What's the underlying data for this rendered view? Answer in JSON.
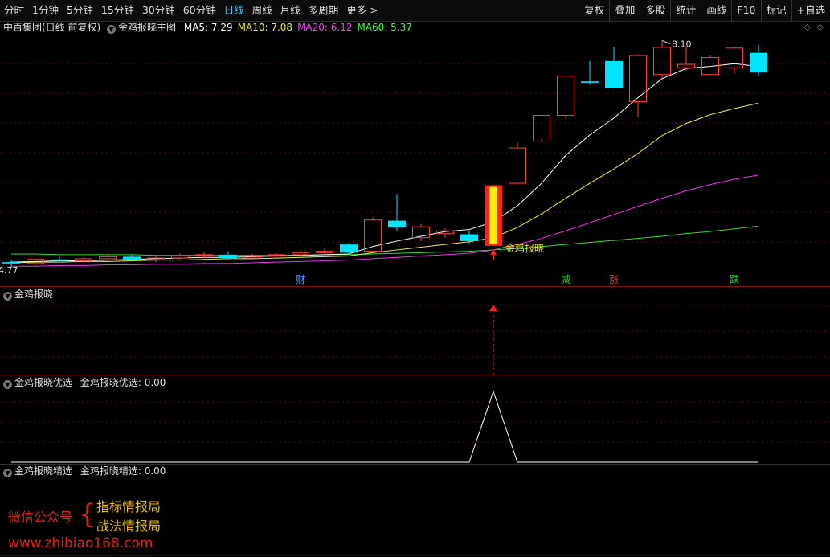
{
  "toolbar": {
    "periods": [
      "分时",
      "1分钟",
      "5分钟",
      "15分钟",
      "30分钟",
      "60分钟",
      "日线",
      "周线",
      "月线",
      "多周期",
      "更多 >"
    ],
    "active_period": "日线",
    "buttons": [
      "复权",
      "叠加",
      "多股",
      "统计",
      "画线",
      "F10",
      "标记",
      "+自选"
    ]
  },
  "main_panel": {
    "stock_title": "中百集团(日线 前复权)",
    "indicator_name": "金鸡报晓主图",
    "ma": [
      {
        "label": "MA5: 7.29",
        "color": "#ffffff"
      },
      {
        "label": "MA10: 7.08",
        "color": "#f0f000"
      },
      {
        "label": "MA20: 6.12",
        "color": "#ff33ff"
      },
      {
        "label": "MA60: 5.37",
        "color": "#33ff33"
      }
    ],
    "high_label": "8.10",
    "low_label": "4.77",
    "signal_label": "金鸡报晓",
    "markers": [
      {
        "text": "财",
        "color": "#4499ff"
      },
      {
        "text": "减",
        "color": "#33cc33"
      },
      {
        "text": "涨",
        "color": "#ff3333"
      },
      {
        "text": "跌",
        "color": "#33cc33"
      }
    ]
  },
  "sub_panel_1": {
    "title": "金鸡报晓"
  },
  "sub_panel_2": {
    "title": "金鸡报晓优选",
    "value_label": "金鸡报晓优选: 0.00"
  },
  "sub_panel_3": {
    "title": "金鸡报晓精选",
    "value_label": "金鸡报晓精选: 0.00"
  },
  "watermark": {
    "label": "微信公众号",
    "line1": "指标情报局",
    "line2": "战法情报局",
    "url": "www.zhibiao168.com"
  },
  "chart_data": {
    "type": "candlestick",
    "candles": [
      {
        "o": 4.84,
        "h": 4.87,
        "l": 4.77,
        "c": 4.82
      },
      {
        "o": 4.82,
        "h": 4.9,
        "l": 4.79,
        "c": 4.88
      },
      {
        "o": 4.88,
        "h": 4.92,
        "l": 4.84,
        "c": 4.86
      },
      {
        "o": 4.86,
        "h": 4.91,
        "l": 4.83,
        "c": 4.89
      },
      {
        "o": 4.89,
        "h": 4.96,
        "l": 4.86,
        "c": 4.92
      },
      {
        "o": 4.92,
        "h": 4.95,
        "l": 4.85,
        "c": 4.87
      },
      {
        "o": 4.87,
        "h": 4.93,
        "l": 4.84,
        "c": 4.9
      },
      {
        "o": 4.9,
        "h": 4.97,
        "l": 4.87,
        "c": 4.94
      },
      {
        "o": 4.94,
        "h": 4.99,
        "l": 4.9,
        "c": 4.95
      },
      {
        "o": 4.95,
        "h": 5.0,
        "l": 4.88,
        "c": 4.9
      },
      {
        "o": 4.9,
        "h": 4.96,
        "l": 4.87,
        "c": 4.93
      },
      {
        "o": 4.93,
        "h": 4.98,
        "l": 4.89,
        "c": 4.95
      },
      {
        "o": 4.95,
        "h": 5.02,
        "l": 4.91,
        "c": 4.98
      },
      {
        "o": 4.98,
        "h": 5.04,
        "l": 4.94,
        "c": 5.0
      },
      {
        "o": 5.1,
        "h": 5.12,
        "l": 4.97,
        "c": 4.98
      },
      {
        "o": 5.0,
        "h": 5.5,
        "l": 4.99,
        "c": 5.46
      },
      {
        "o": 5.45,
        "h": 5.84,
        "l": 5.3,
        "c": 5.35
      },
      {
        "o": 5.2,
        "h": 5.4,
        "l": 5.15,
        "c": 5.36
      },
      {
        "o": 5.26,
        "h": 5.34,
        "l": 5.2,
        "c": 5.3
      },
      {
        "o": 5.25,
        "h": 5.31,
        "l": 5.1,
        "c": 5.15
      },
      {
        "o": 5.08,
        "h": 5.98,
        "l": 5.08,
        "c": 5.97
      },
      {
        "o": 6.0,
        "h": 6.6,
        "l": 5.98,
        "c": 6.52
      },
      {
        "o": 6.62,
        "h": 7.0,
        "l": 6.66,
        "c": 7.0
      },
      {
        "o": 7.0,
        "h": 7.58,
        "l": 6.95,
        "c": 7.58
      },
      {
        "o": 7.5,
        "h": 7.8,
        "l": 7.45,
        "c": 7.48
      },
      {
        "o": 7.8,
        "h": 8.0,
        "l": 7.4,
        "c": 7.4
      },
      {
        "o": 7.2,
        "h": 7.9,
        "l": 6.98,
        "c": 7.88
      },
      {
        "o": 7.6,
        "h": 8.1,
        "l": 7.55,
        "c": 8.0
      },
      {
        "o": 7.7,
        "h": 8.02,
        "l": 7.66,
        "c": 7.75
      },
      {
        "o": 7.6,
        "h": 7.88,
        "l": 7.58,
        "c": 7.85
      },
      {
        "o": 7.7,
        "h": 8.02,
        "l": 7.62,
        "c": 7.99
      },
      {
        "o": 7.92,
        "h": 8.04,
        "l": 7.58,
        "c": 7.63
      }
    ],
    "signal_index": 20,
    "ma5": [
      4.84,
      4.85,
      4.86,
      4.86,
      4.87,
      4.88,
      4.89,
      4.9,
      4.91,
      4.91,
      4.92,
      4.93,
      4.94,
      4.95,
      4.96,
      5.07,
      5.15,
      5.22,
      5.29,
      5.32,
      5.43,
      5.67,
      6.0,
      6.41,
      6.71,
      6.96,
      7.26,
      7.54,
      7.69,
      7.72,
      7.76,
      7.72
    ],
    "ma10": [
      4.83,
      4.84,
      4.84,
      4.85,
      4.85,
      4.86,
      4.87,
      4.87,
      4.88,
      4.89,
      4.89,
      4.9,
      4.91,
      4.92,
      4.93,
      4.98,
      5.02,
      5.06,
      5.1,
      5.14,
      5.2,
      5.35,
      5.55,
      5.78,
      6.0,
      6.21,
      6.44,
      6.7,
      6.88,
      7.01,
      7.1,
      7.18
    ],
    "ma20": [
      4.78,
      4.78,
      4.79,
      4.79,
      4.8,
      4.8,
      4.81,
      4.81,
      4.82,
      4.82,
      4.83,
      4.84,
      4.85,
      4.86,
      4.87,
      4.89,
      4.91,
      4.93,
      4.95,
      4.97,
      5.02,
      5.1,
      5.19,
      5.3,
      5.42,
      5.54,
      5.66,
      5.78,
      5.89,
      5.98,
      6.06,
      6.12
    ],
    "ma60": [
      4.96,
      4.96,
      4.95,
      4.95,
      4.95,
      4.95,
      4.94,
      4.94,
      4.94,
      4.94,
      4.94,
      4.94,
      4.94,
      4.95,
      4.95,
      4.96,
      4.97,
      4.98,
      4.99,
      5.0,
      5.02,
      5.04,
      5.07,
      5.1,
      5.13,
      5.16,
      5.19,
      5.22,
      5.26,
      5.29,
      5.33,
      5.37
    ],
    "youxuan": [
      0,
      0,
      0,
      0,
      0,
      0,
      0,
      0,
      0,
      0,
      0,
      0,
      0,
      0,
      0,
      0,
      0,
      0,
      0,
      0,
      1,
      0,
      0,
      0,
      0,
      0,
      0,
      0,
      0,
      0,
      0,
      0
    ],
    "marker_indices": [
      12,
      23,
      25,
      30
    ]
  }
}
